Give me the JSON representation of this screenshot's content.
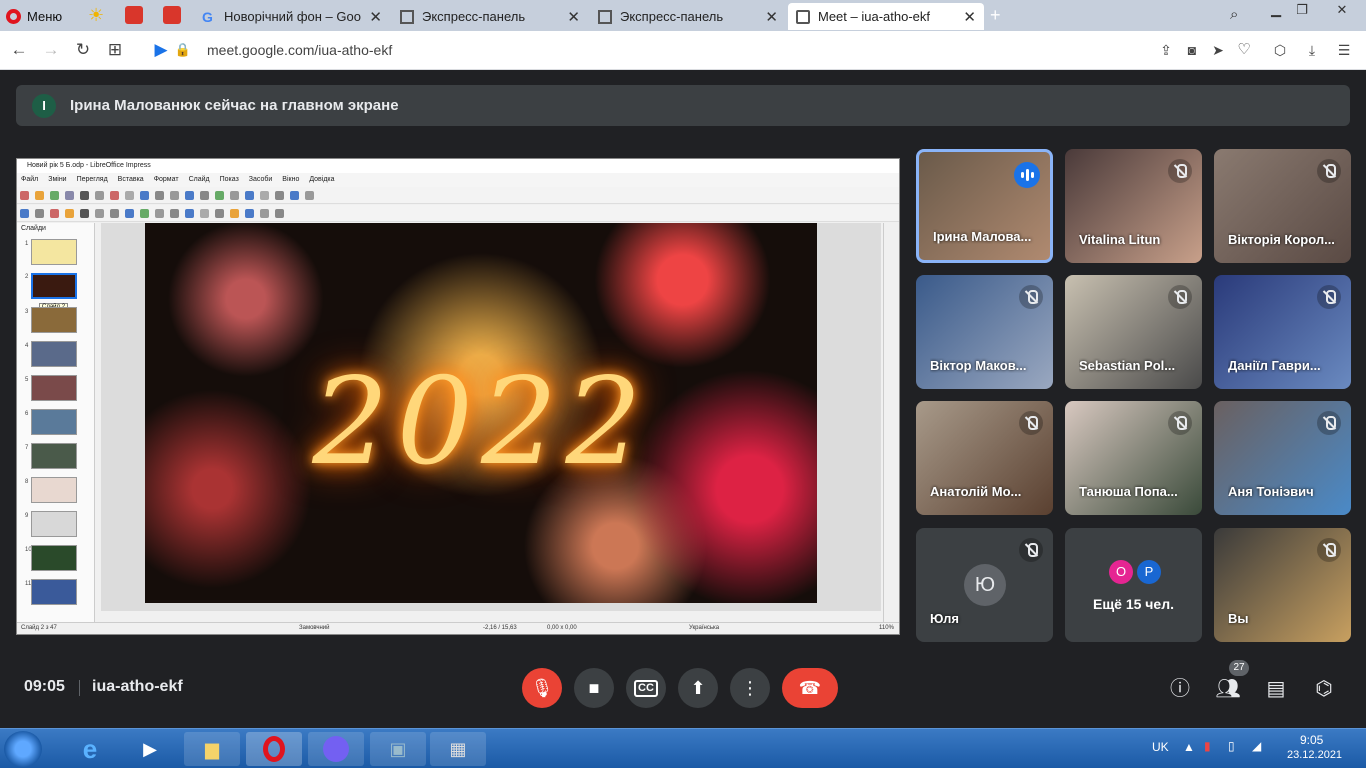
{
  "browser": {
    "menu_label": "Меню",
    "tabs": [
      {
        "label": "Новорічний фон – Google",
        "active": false
      },
      {
        "label": "Экспресс-панель",
        "active": false
      },
      {
        "label": "Экспресс-панель",
        "active": false
      },
      {
        "label": "Meet – iua-atho-ekf",
        "active": true
      }
    ],
    "new_tab": "+",
    "url": "meet.google.com/iua-atho-ekf"
  },
  "meet": {
    "banner": {
      "avatar_letter": "І",
      "text": "Ірина Малованюк сейчас на главном экране"
    },
    "participants": [
      {
        "name": "Ірина Малова...",
        "state": "speaking"
      },
      {
        "name": "Vitalina Litun",
        "state": "muted"
      },
      {
        "name": "Вікторія Корол...",
        "state": "muted"
      },
      {
        "name": "Віктор Маков...",
        "state": "muted"
      },
      {
        "name": "Sebastian Pol...",
        "state": "muted"
      },
      {
        "name": "Даніїл Гаври...",
        "state": "muted"
      },
      {
        "name": "Анатолій Мо...",
        "state": "muted"
      },
      {
        "name": "Танюша Попа...",
        "state": "muted"
      },
      {
        "name": "Аня Тоніэвич",
        "state": "muted"
      },
      {
        "name": "Юля",
        "state": "muted",
        "avatar_letter": "Ю"
      },
      {
        "name": "Ещё 15 чел.",
        "state": "more",
        "avatars": [
          "O",
          "P"
        ]
      },
      {
        "name": "Вы",
        "state": "muted"
      }
    ],
    "clock": "09:05",
    "meeting_code": "iua-atho-ekf",
    "people_count": "27"
  },
  "presentation": {
    "window_title": "Новий рік 5 Б.odp - LibreOffice Impress",
    "menu": [
      "Файл",
      "Зміни",
      "Перегляд",
      "Вставка",
      "Формат",
      "Слайд",
      "Показ",
      "Засоби",
      "Вікно",
      "Довідка"
    ],
    "slides_title": "Слайди",
    "slide_text": "2022",
    "tooltip": "Слайд 2",
    "status": {
      "slide": "Слайд 2 з 47",
      "layout": "Замовчний",
      "coords": "-2,16 / 15,63",
      "size": "0,00 x 0,00",
      "lang": "Українська",
      "zoom": "110%"
    }
  },
  "taskbar": {
    "lang": "UK",
    "time": "9:05",
    "date": "23.12.2021"
  }
}
